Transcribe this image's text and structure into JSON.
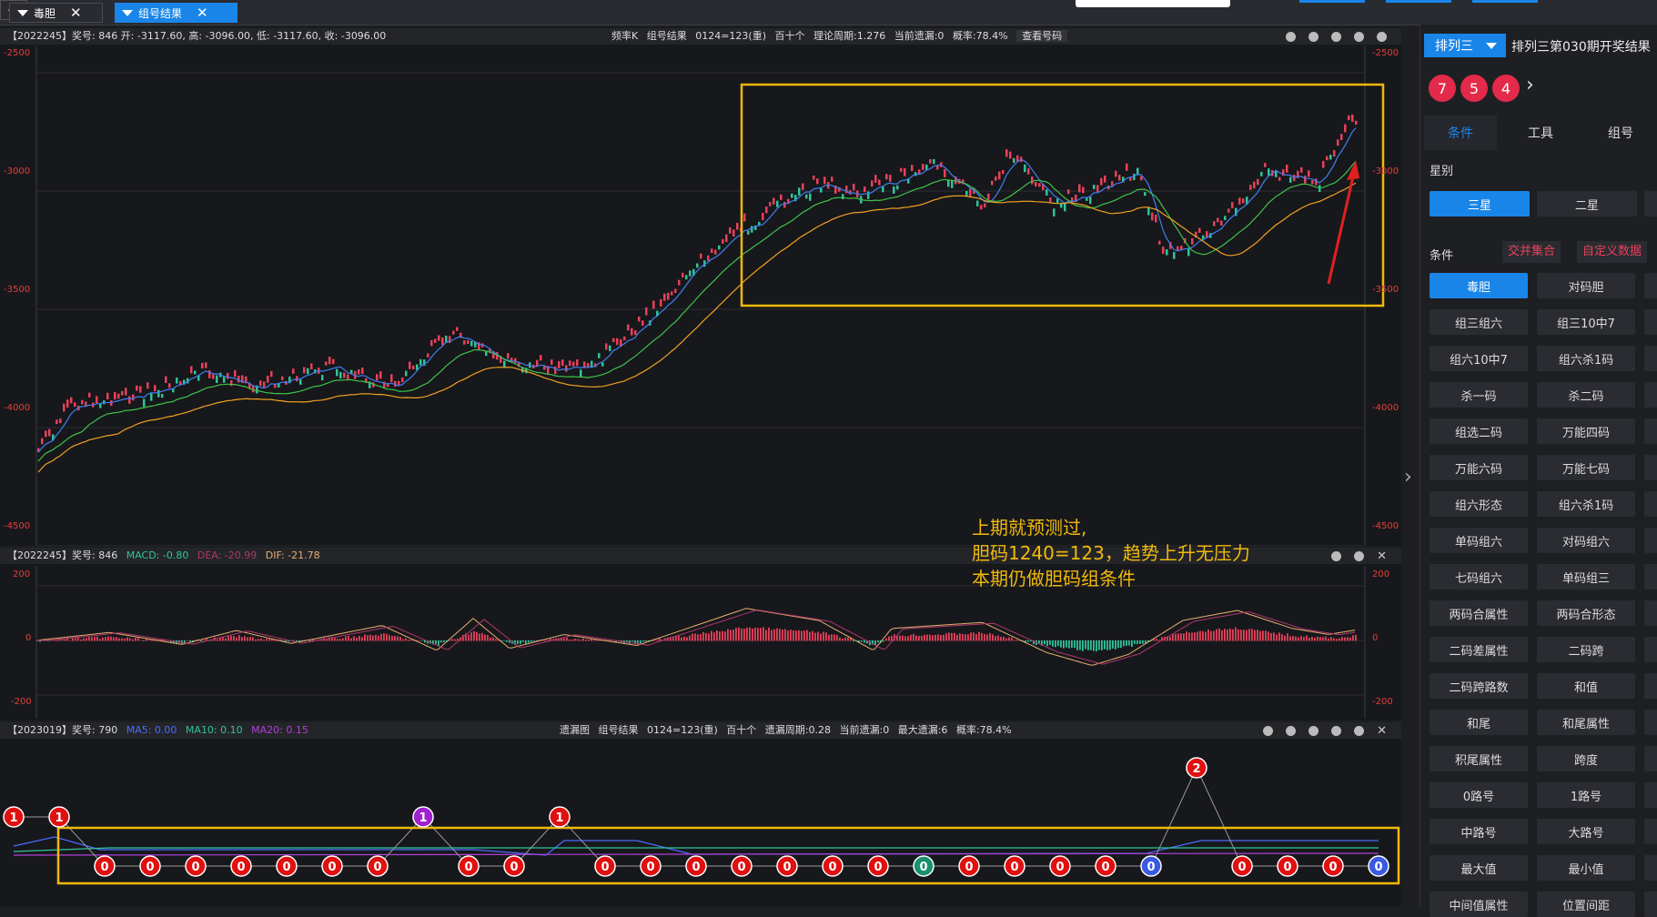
{
  "tabs": [
    {
      "label": "毒胆"
    },
    {
      "label": "组号结果"
    }
  ],
  "kline_header": {
    "info": "【2022245】奖号: 846  开: -3117.60, 高: -3096.00, 低: -3117.60, 收: -3096.00",
    "type": "频率K",
    "result": "组号结果",
    "combo": "0124=123(重)",
    "pos": "百十个",
    "period": "理论周期:1.276",
    "miss": "当前遗漏:0",
    "prob": "概率:78.4%",
    "btn": "查看号码"
  },
  "kline_axis": [
    "-2500",
    "-3000",
    "-3500",
    "-4000",
    "-4500"
  ],
  "macd_header": {
    "info": "【2022245】奖号: 846",
    "macd": "MACD: -0.80",
    "dea": "DEA: -20.99",
    "dif": "DIF: -21.78"
  },
  "macd_axis": [
    "200",
    "0",
    "-200"
  ],
  "miss_header": {
    "info": "【2023019】奖号: 790",
    "ma5": "MA5: 0.00",
    "ma10": "MA10: 0.10",
    "ma20": "MA20: 0.15",
    "type": "遗漏图",
    "result": "组号结果",
    "combo": "0124=123(重)",
    "pos": "百十个",
    "period": "遗漏周期:0.28",
    "miss": "当前遗漏:0",
    "maxmiss": "最大遗漏:6",
    "prob": "概率:78.4%"
  },
  "miss_values": [
    1,
    1,
    0,
    0,
    0,
    0,
    0,
    0,
    0,
    1,
    0,
    0,
    1,
    0,
    0,
    0,
    0,
    0,
    0,
    0,
    0,
    0,
    0,
    0,
    0,
    0,
    2,
    0,
    0,
    0,
    0
  ],
  "note": "上期就预测过,\n胆码1240=123，趋势上升无压力\n本期仍做胆码组条件",
  "sidebar": {
    "lottery": "排列三",
    "draw_title": "排列三第030期开奖结果",
    "balls": [
      "7",
      "5",
      "4"
    ],
    "tabs": [
      "条件",
      "工具",
      "组号"
    ],
    "star_label": "星别",
    "stars": [
      "三星",
      "二星"
    ],
    "cond_label": "条件",
    "links": [
      "交并集合",
      "自定义数据"
    ],
    "buttons": [
      [
        "毒胆",
        "对码胆"
      ],
      [
        "组三组六",
        "组三10中7"
      ],
      [
        "组六10中7",
        "组六杀1码"
      ],
      [
        "杀一码",
        "杀二码"
      ],
      [
        "组选二码",
        "万能四码"
      ],
      [
        "万能六码",
        "万能七码"
      ],
      [
        "组六形态",
        "组六杀1码"
      ],
      [
        "单码组六",
        "对码组六"
      ],
      [
        "七码组六",
        "单码组三"
      ],
      [
        "两码合属性",
        "两码合形态"
      ],
      [
        "二码差属性",
        "二码跨"
      ],
      [
        "二码跨路数",
        "和值"
      ],
      [
        "和尾",
        "和尾属性"
      ],
      [
        "积尾属性",
        "跨度"
      ],
      [
        "0路号",
        "1路号"
      ],
      [
        "中路号",
        "大路号"
      ],
      [
        "最大值",
        "最小值"
      ],
      [
        "中间值属性",
        "位置间距"
      ]
    ]
  },
  "colors": {
    "up": "#e8415a",
    "down": "#2fc49a",
    "accent": "#1a85e8",
    "box": "#f0b90b"
  }
}
